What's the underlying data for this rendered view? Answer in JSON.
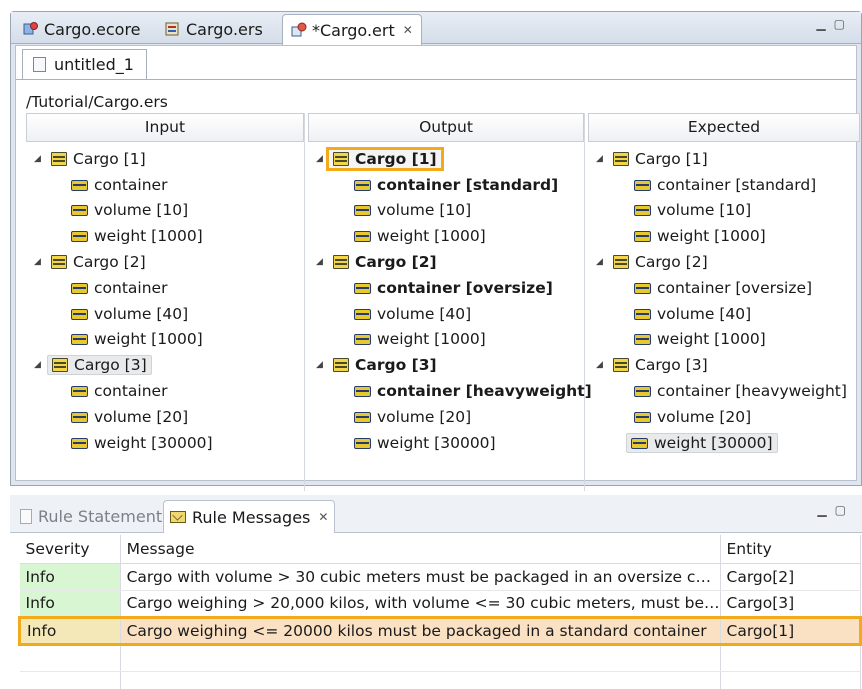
{
  "editor_tabs": [
    {
      "label": "Cargo.ecore"
    },
    {
      "label": "Cargo.ers"
    },
    {
      "label": "*Cargo.ert"
    }
  ],
  "subtab": {
    "label": "untitled_1"
  },
  "path": "/Tutorial/Cargo.ers",
  "columns": {
    "input": {
      "header": "Input",
      "items": [
        {
          "label": "Cargo [1]"
        },
        {
          "label": "container"
        },
        {
          "label": "volume [10]"
        },
        {
          "label": "weight [1000]"
        },
        {
          "label": "Cargo [2]"
        },
        {
          "label": "container"
        },
        {
          "label": "volume [40]"
        },
        {
          "label": "weight [1000]"
        },
        {
          "label": "Cargo [3]"
        },
        {
          "label": "container"
        },
        {
          "label": "volume [20]"
        },
        {
          "label": "weight [30000]"
        }
      ]
    },
    "output": {
      "header": "Output",
      "items": [
        {
          "label": "Cargo [1]"
        },
        {
          "label": "container [standard]"
        },
        {
          "label": "volume [10]"
        },
        {
          "label": "weight [1000]"
        },
        {
          "label": "Cargo [2]"
        },
        {
          "label": "container [oversize]"
        },
        {
          "label": "volume [40]"
        },
        {
          "label": "weight [1000]"
        },
        {
          "label": "Cargo [3]"
        },
        {
          "label": "container [heavyweight]"
        },
        {
          "label": "volume [20]"
        },
        {
          "label": "weight [30000]"
        }
      ]
    },
    "expected": {
      "header": "Expected",
      "items": [
        {
          "label": "Cargo [1]"
        },
        {
          "label": "container [standard]"
        },
        {
          "label": "volume [10]"
        },
        {
          "label": "weight [1000]"
        },
        {
          "label": "Cargo [2]"
        },
        {
          "label": "container [oversize]"
        },
        {
          "label": "volume [40]"
        },
        {
          "label": "weight [1000]"
        },
        {
          "label": "Cargo [3]"
        },
        {
          "label": "container [heavyweight]"
        },
        {
          "label": "volume [20]"
        },
        {
          "label": "weight [30000]"
        }
      ]
    }
  },
  "view_tabs": [
    {
      "label": "Rule Statements"
    },
    {
      "label": "Rule Messages"
    }
  ],
  "messages": {
    "headers": {
      "severity": "Severity",
      "message": "Message",
      "entity": "Entity"
    },
    "rows": [
      {
        "severity": "Info",
        "message": "Cargo with volume > 30 cubic meters must be packaged in an oversize c…",
        "entity": "Cargo[2]"
      },
      {
        "severity": "Info",
        "message": "Cargo weighing > 20,000 kilos, with volume <= 30 cubic meters, must be…",
        "entity": "Cargo[3]"
      },
      {
        "severity": "Info",
        "message": "Cargo weighing <= 20000 kilos must be packaged in a standard container",
        "entity": "Cargo[1]"
      }
    ]
  },
  "colors": {
    "highlight": "#f2a91a",
    "info_bg": "#d9f6d3",
    "selected_row_bg": "#fbe1c3"
  }
}
